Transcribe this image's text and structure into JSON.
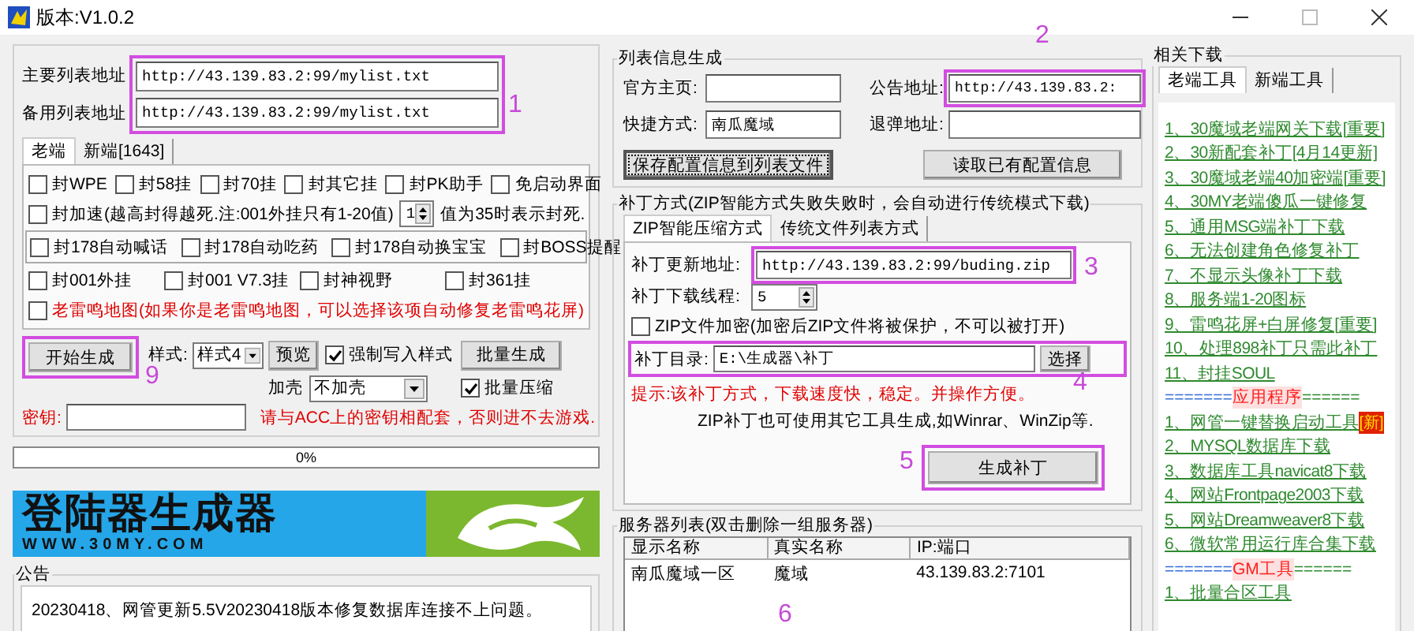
{
  "window": {
    "title": "版本:V1.0.2"
  },
  "list_urls": [
    {
      "label": "主要列表地址",
      "value": "http://43.139.83.2:99/mylist.txt"
    },
    {
      "label": "备用列表地址",
      "value": "http://43.139.83.2:99/mylist.txt"
    }
  ],
  "client_tabs": [
    {
      "label": "老端",
      "selected": true
    },
    {
      "label": "新端[1643]",
      "selected": false
    }
  ],
  "option_rows": [
    {
      "boxed": false,
      "items": [
        {
          "kind": "checkbox",
          "label": "封WPE",
          "checked": false
        },
        {
          "kind": "checkbox",
          "label": "封58挂",
          "checked": false
        },
        {
          "kind": "checkbox",
          "label": "封70挂",
          "checked": false
        },
        {
          "kind": "checkbox",
          "label": "封其它挂",
          "checked": false
        },
        {
          "kind": "checkbox",
          "label": "封PK助手",
          "checked": false
        },
        {
          "kind": "checkbox",
          "label": "免启动界面",
          "checked": false
        }
      ]
    },
    {
      "boxed": false,
      "items": [
        {
          "kind": "checkbox",
          "label": "封加速(越高封得越死.注:001外挂只有1-20值)",
          "checked": false
        },
        {
          "kind": "spinner",
          "value": "1"
        },
        {
          "kind": "text",
          "label": "值为35时表示封死."
        }
      ]
    },
    {
      "boxed": true,
      "items": [
        {
          "kind": "checkbox",
          "label": "封178自动喊话",
          "checked": false
        },
        {
          "kind": "checkbox",
          "label": "封178自动吃药",
          "checked": false
        },
        {
          "kind": "checkbox",
          "label": "封178自动换宝宝",
          "checked": false
        },
        {
          "kind": "checkbox",
          "label": "封BOSS提醒",
          "checked": false
        }
      ]
    },
    {
      "boxed": false,
      "items": [
        {
          "kind": "checkbox",
          "label": "封001外挂",
          "checked": false
        },
        {
          "kind": "checkbox",
          "label": "封001 V7.3挂",
          "checked": false
        },
        {
          "kind": "checkbox",
          "label": "封神视野",
          "checked": false
        },
        {
          "kind": "checkbox",
          "label": "封361挂",
          "checked": false
        }
      ]
    },
    {
      "boxed": false,
      "items": [
        {
          "kind": "warning",
          "label": "老雷鸣地图(如果你是老雷鸣地图，可以选择该项自动修复老雷鸣花屏)",
          "checked": false
        }
      ]
    }
  ],
  "generate": {
    "start_button": "开始生成",
    "style_label": "样式:",
    "style_value": "样式4",
    "preview_button": "预览",
    "force_style": {
      "label": "强制写入样式",
      "checked": true
    },
    "batch_button": "批量生成",
    "shell_label": "加壳",
    "shell_value": "不加壳",
    "batch_compress": {
      "label": "批量压缩",
      "checked": true
    },
    "key_label": "密钥:",
    "key_hint": "请与ACC上的密钥相配套，否则进不去游戏."
  },
  "progress": {
    "level": 0,
    "text": "0%"
  },
  "banner": {
    "title": "登陆器生成器",
    "url": "WWW.30MY.COM"
  },
  "notice": {
    "title": "公告",
    "text": "20230418、网管更新5.5V20230418版本修复数据库连接不上问题。"
  },
  "list_info": {
    "title": "列表信息生成",
    "fields": [
      {
        "label": "官方主页:"
      },
      {
        "label": "公告地址:",
        "value": "http://43.139.83.2:"
      },
      {
        "label": "快捷方式:",
        "value": "南瓜魔域"
      },
      {
        "label": "退弹地址:"
      }
    ],
    "save_button": "保存配置信息到列表文件",
    "read_button": "读取已有配置信息"
  },
  "patch": {
    "title": "补丁方式(ZIP智能方式失败失败时，会自动进行传统模式下载)",
    "tabs": [
      {
        "label": "ZIP智能压缩方式",
        "selected": true
      },
      {
        "label": "传统文件列表方式",
        "selected": false
      }
    ],
    "url_label": "补丁更新地址:",
    "url_value": "http://43.139.83.2:99/buding.zip",
    "threads_label": "补丁下载线程:",
    "threads_value": "5",
    "encrypt": {
      "label": "ZIP文件加密(加密后ZIP文件将被保护，不可以被打开)",
      "checked": false
    },
    "dir_label": "补丁目录:",
    "dir_value": "E:\\生成器\\补丁",
    "choose_button": "选择",
    "hint": "提示:该补丁方式，下载速度快，稳定。并操作方便。",
    "note": "ZIP补丁也可使用其它工具生成,如Winrar、WinZip等.",
    "make_button": "生成补丁"
  },
  "servers": {
    "title": "服务器列表(双击删除一组服务器)",
    "columns": [
      "显示名称",
      "真实名称",
      "IP:端口"
    ],
    "rows": [
      [
        "南瓜魔域一区",
        "魔域",
        "43.139.83.2:7101"
      ]
    ]
  },
  "downloads": {
    "title": "相关下载",
    "tabs": [
      {
        "label": "老端工具",
        "selected": true
      },
      {
        "label": "新端工具",
        "selected": false
      }
    ],
    "items": [
      {
        "kind": "link",
        "text": "1、30魔域老端网关下载[重要]"
      },
      {
        "kind": "link",
        "text": "2、30新配套补丁[4月14更新]"
      },
      {
        "kind": "link",
        "text": "3、30魔域老端40加密端[重要]"
      },
      {
        "kind": "link",
        "text": "4、30MY老端傻瓜一键修复"
      },
      {
        "kind": "link",
        "text": "5、通用MSG端补丁下载"
      },
      {
        "kind": "link",
        "text": "6、无法创建角色修复补丁"
      },
      {
        "kind": "link",
        "text": "7、不显示头像补丁下载"
      },
      {
        "kind": "link",
        "text": "8、服务端1-20图标"
      },
      {
        "kind": "link",
        "text": "9、雷鸣花屏+白屏修复[重要]"
      },
      {
        "kind": "link",
        "text": "10、处理898补丁只需此补丁"
      },
      {
        "kind": "link",
        "text": "11、封挂SOUL"
      },
      {
        "kind": "separator",
        "left": "=======",
        "title": "应用程序",
        "right": "======"
      },
      {
        "kind": "link",
        "text": "1、网管一键替换启动工具",
        "badge": "[新]"
      },
      {
        "kind": "link",
        "text": "2、MYSQL数据库下载"
      },
      {
        "kind": "link",
        "text": "3、数据库工具navicat8下载"
      },
      {
        "kind": "link",
        "text": "4、网站Frontpage2003下载"
      },
      {
        "kind": "link",
        "text": "5、网站Dreamweaver8下载"
      },
      {
        "kind": "link",
        "text": "6、微软常用运行库合集下载"
      },
      {
        "kind": "separator",
        "left": "=======",
        "title": "GM工具",
        "right": "======"
      },
      {
        "kind": "link",
        "text": "1、批量合区工具"
      }
    ]
  },
  "annotations": [
    {
      "label": "1",
      "framed": true
    },
    {
      "label": "2",
      "framed": true
    },
    {
      "label": "3",
      "framed": true
    },
    {
      "label": "4",
      "framed": true
    },
    {
      "label": "5",
      "framed": true
    },
    {
      "label": "6",
      "framed": false
    },
    {
      "label": "9",
      "framed": true
    }
  ]
}
